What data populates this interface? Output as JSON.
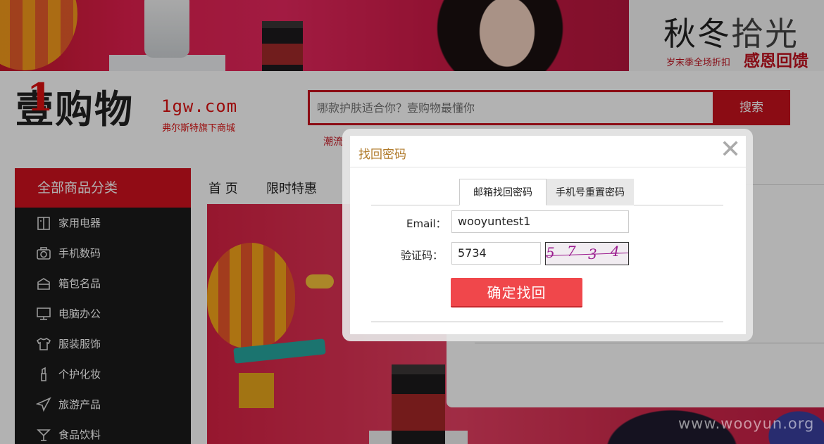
{
  "banner": {
    "headline_dark": "秋冬",
    "headline_light": "拾光",
    "tagline": "岁末季全场折扣",
    "tagline_red": "感恩回馈"
  },
  "header": {
    "logo_one": "1",
    "logo_cn": "壹购物",
    "logo_en": "1gw.com",
    "logo_sub": "弗尔斯特旗下商城",
    "search_placeholder": "哪款护肤适合你？壹购物最懂你",
    "search_button": "搜索",
    "hot_keyword": "潮流"
  },
  "sidebar": {
    "title": "全部商品分类",
    "items": [
      {
        "label": "家用电器",
        "icon": "appliance-icon"
      },
      {
        "label": "手机数码",
        "icon": "camera-icon"
      },
      {
        "label": "箱包名品",
        "icon": "bag-icon"
      },
      {
        "label": "电脑办公",
        "icon": "monitor-icon"
      },
      {
        "label": "服装服饰",
        "icon": "shirt-icon"
      },
      {
        "label": "个护化妆",
        "icon": "lipstick-icon"
      },
      {
        "label": "旅游产品",
        "icon": "plane-icon"
      },
      {
        "label": "食品饮料",
        "icon": "cocktail-icon"
      }
    ]
  },
  "nav": {
    "home": "首 页",
    "flash_sale": "限时特惠"
  },
  "modal": {
    "title": "找回密码",
    "close": "✕",
    "tab_email": "邮箱找回密码",
    "tab_phone": "手机号重置密码",
    "email_label": "Email：",
    "email_value": "wooyuntest1",
    "captcha_label": "验证码：",
    "captcha_value": "5734",
    "captcha_image_chars": [
      "5",
      "7",
      "3",
      "4"
    ],
    "submit": "确定找回"
  },
  "watermark": "www.wooyun.org",
  "colors": {
    "brand_red": "#c8121e",
    "button_red": "#f0474b",
    "title_gold": "#b07a2a",
    "captcha_purple": "#9b1d8f"
  }
}
